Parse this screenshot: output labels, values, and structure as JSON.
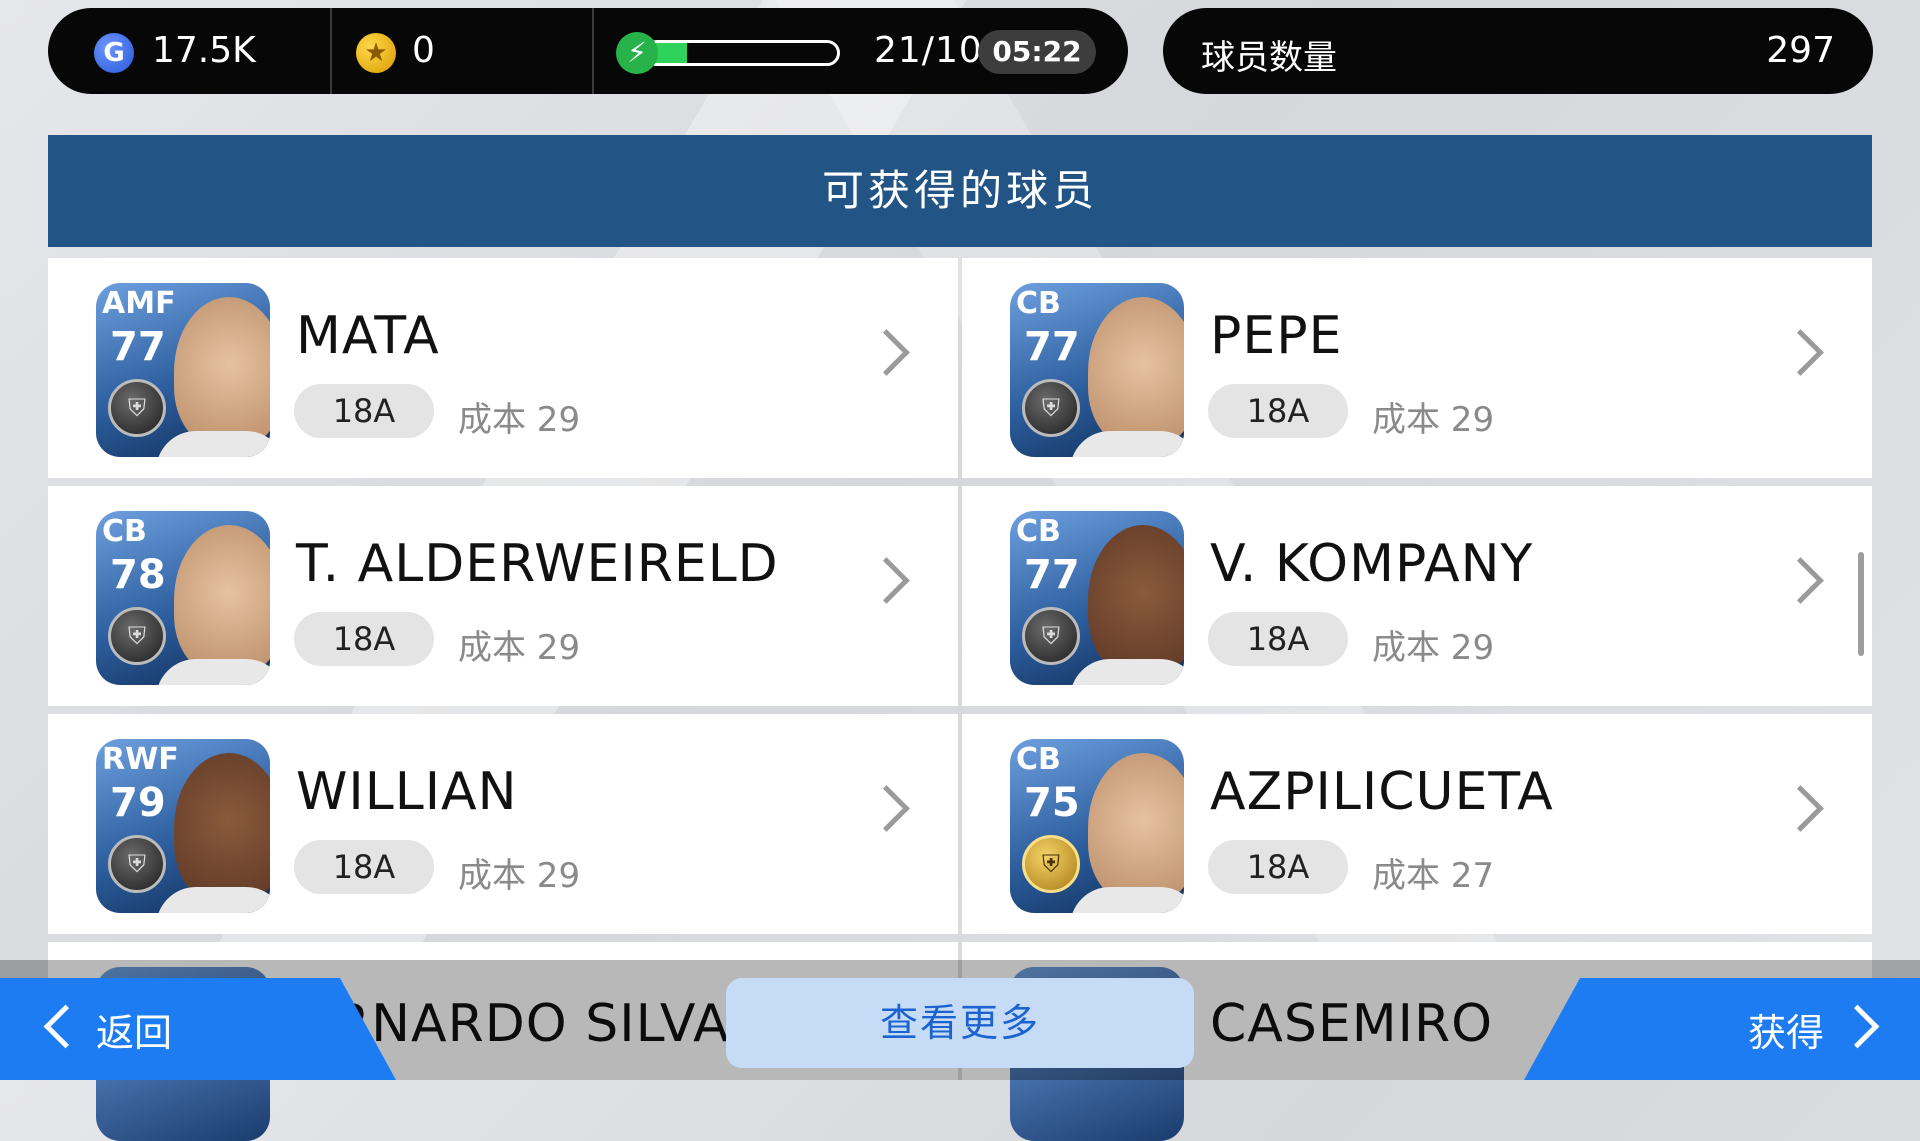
{
  "status": {
    "gp_icon": "gp-coin-icon",
    "gp_value": "17.5K",
    "coin_icon": "star-coin-icon",
    "coin_value": "0",
    "energy_icon": "lightning-icon",
    "energy_fraction": 0.21,
    "energy_text": "21/100",
    "timer": "05:22",
    "player_count_label": "球员数量",
    "player_count_value": "297"
  },
  "header": {
    "title": "可获得的球员"
  },
  "players": [
    {
      "pos": "AMF",
      "rating": "77",
      "name": "MATA",
      "tag": "18A",
      "cost": "成本 29",
      "badge": "silver",
      "skin": "light"
    },
    {
      "pos": "CB",
      "rating": "77",
      "name": "PEPE",
      "tag": "18A",
      "cost": "成本 29",
      "badge": "silver",
      "skin": "light"
    },
    {
      "pos": "CB",
      "rating": "78",
      "name": "T. ALDERWEIRELD",
      "tag": "18A",
      "cost": "成本 29",
      "badge": "silver",
      "skin": "light"
    },
    {
      "pos": "CB",
      "rating": "77",
      "name": "V. KOMPANY",
      "tag": "18A",
      "cost": "成本 29",
      "badge": "silver",
      "skin": "dark"
    },
    {
      "pos": "RWF",
      "rating": "79",
      "name": "WILLIAN",
      "tag": "18A",
      "cost": "成本 29",
      "badge": "silver",
      "skin": "dark"
    },
    {
      "pos": "CB",
      "rating": "75",
      "name": "AZPILICUETA",
      "tag": "18A",
      "cost": "成本 27",
      "badge": "gold",
      "skin": "light"
    }
  ],
  "partial_row": {
    "left_name": "RNARDO SILVA",
    "right_name": "CASEMIRO"
  },
  "bottom": {
    "back_label": "返回",
    "more_label": "查看更多",
    "get_label": "获得"
  },
  "colors": {
    "header": "#235486",
    "action_blue": "#1e7cf2",
    "more_bg": "#c6dcf6"
  }
}
